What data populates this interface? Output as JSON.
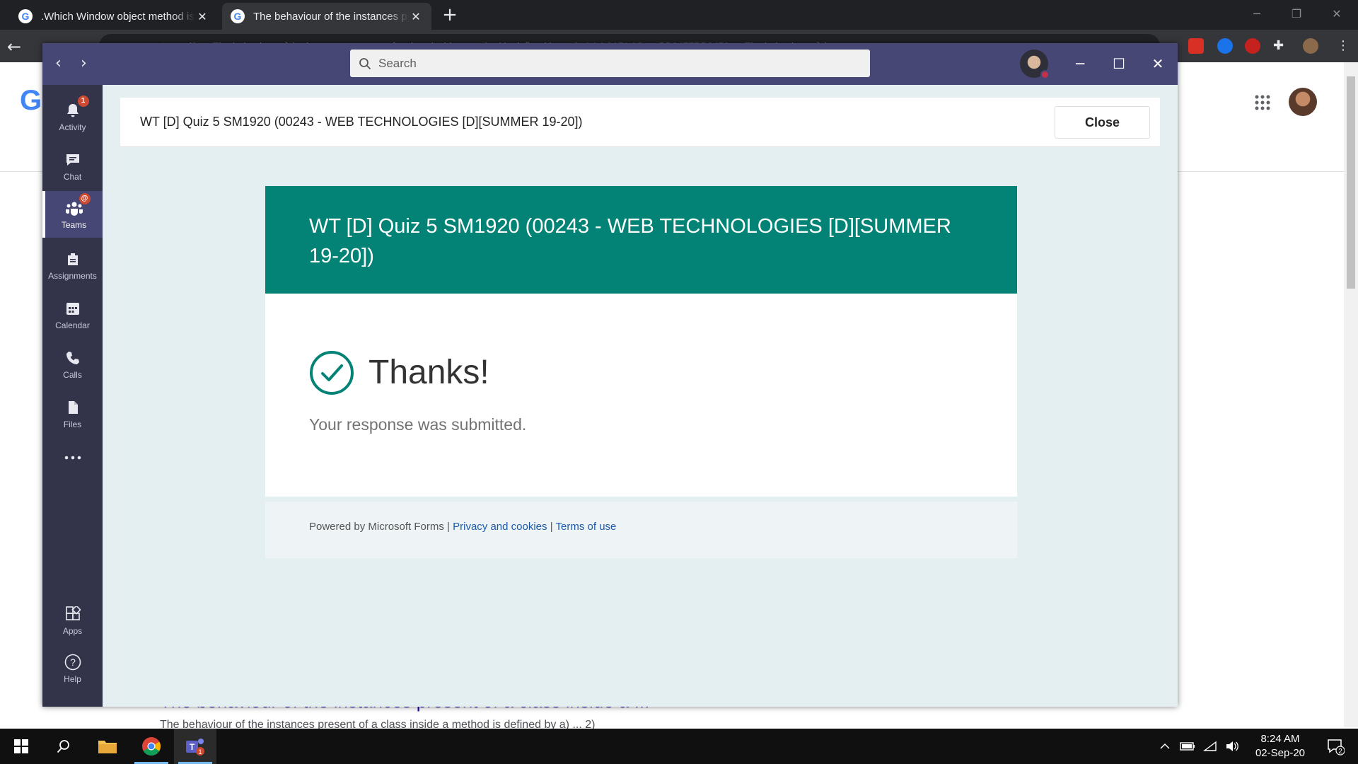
{
  "browser": {
    "tabs": [
      {
        "title": ".Which Window object method is",
        "favicon": "G"
      },
      {
        "title": "The behaviour of the instances pr",
        "favicon": "G"
      }
    ],
    "new_tab_label": "+",
    "address": "…s=cu_rest=oscd3=…The behaviour of the instances present of a class inside a method is defined by ... 2=1rLAC1PLAS … BB0477BB2470 … The behaviour of the …",
    "colors": {
      "titlebar": "#202124",
      "toolbar": "#35363a"
    }
  },
  "google_page": {
    "logo": "G",
    "result_link": "The behaviour of the instances present of a class inside a ...",
    "result_snippet": "The behaviour of the instances present of a class inside a method is defined by a) ... 2)"
  },
  "teams": {
    "search": {
      "placeholder": "Search"
    },
    "rail": [
      {
        "label": "Activity",
        "icon": "bell-icon",
        "badge": "1"
      },
      {
        "label": "Chat",
        "icon": "chat-icon",
        "badge": ""
      },
      {
        "label": "Teams",
        "icon": "teams-icon",
        "badge": "@",
        "active": true
      },
      {
        "label": "Assignments",
        "icon": "assignments-icon",
        "badge": ""
      },
      {
        "label": "Calendar",
        "icon": "calendar-icon",
        "badge": ""
      },
      {
        "label": "Calls",
        "icon": "phone-icon",
        "badge": ""
      },
      {
        "label": "Files",
        "icon": "files-icon",
        "badge": ""
      },
      {
        "label": "",
        "icon": "more-icon",
        "badge": ""
      }
    ],
    "rail_bottom": [
      {
        "label": "Apps",
        "icon": "apps-icon"
      },
      {
        "label": "Help",
        "icon": "help-icon"
      }
    ],
    "panel": {
      "title": "WT [D] Quiz 5 SM1920 (00243 - WEB TECHNOLOGIES [D][SUMMER 19-20])",
      "close_label": "Close"
    },
    "form": {
      "header": "WT [D] Quiz 5 SM1920 (00243 - WEB TECHNOLOGIES [D][SUMMER 19-20])",
      "thanks": "Thanks!",
      "submitted": "Your response was submitted.",
      "footer": {
        "powered": "Powered by Microsoft Forms |",
        "privacy": "Privacy and cookies",
        "sep": "|",
        "terms": "Terms of use"
      }
    },
    "colors": {
      "bar": "#464775",
      "rail": "#33344a",
      "form_header": "#038375",
      "content_bg": "#e5eff1"
    }
  },
  "taskbar": {
    "time": "8:24 AM",
    "date": "02-Sep-20",
    "teams_badge": "1",
    "notification_count": "2"
  }
}
